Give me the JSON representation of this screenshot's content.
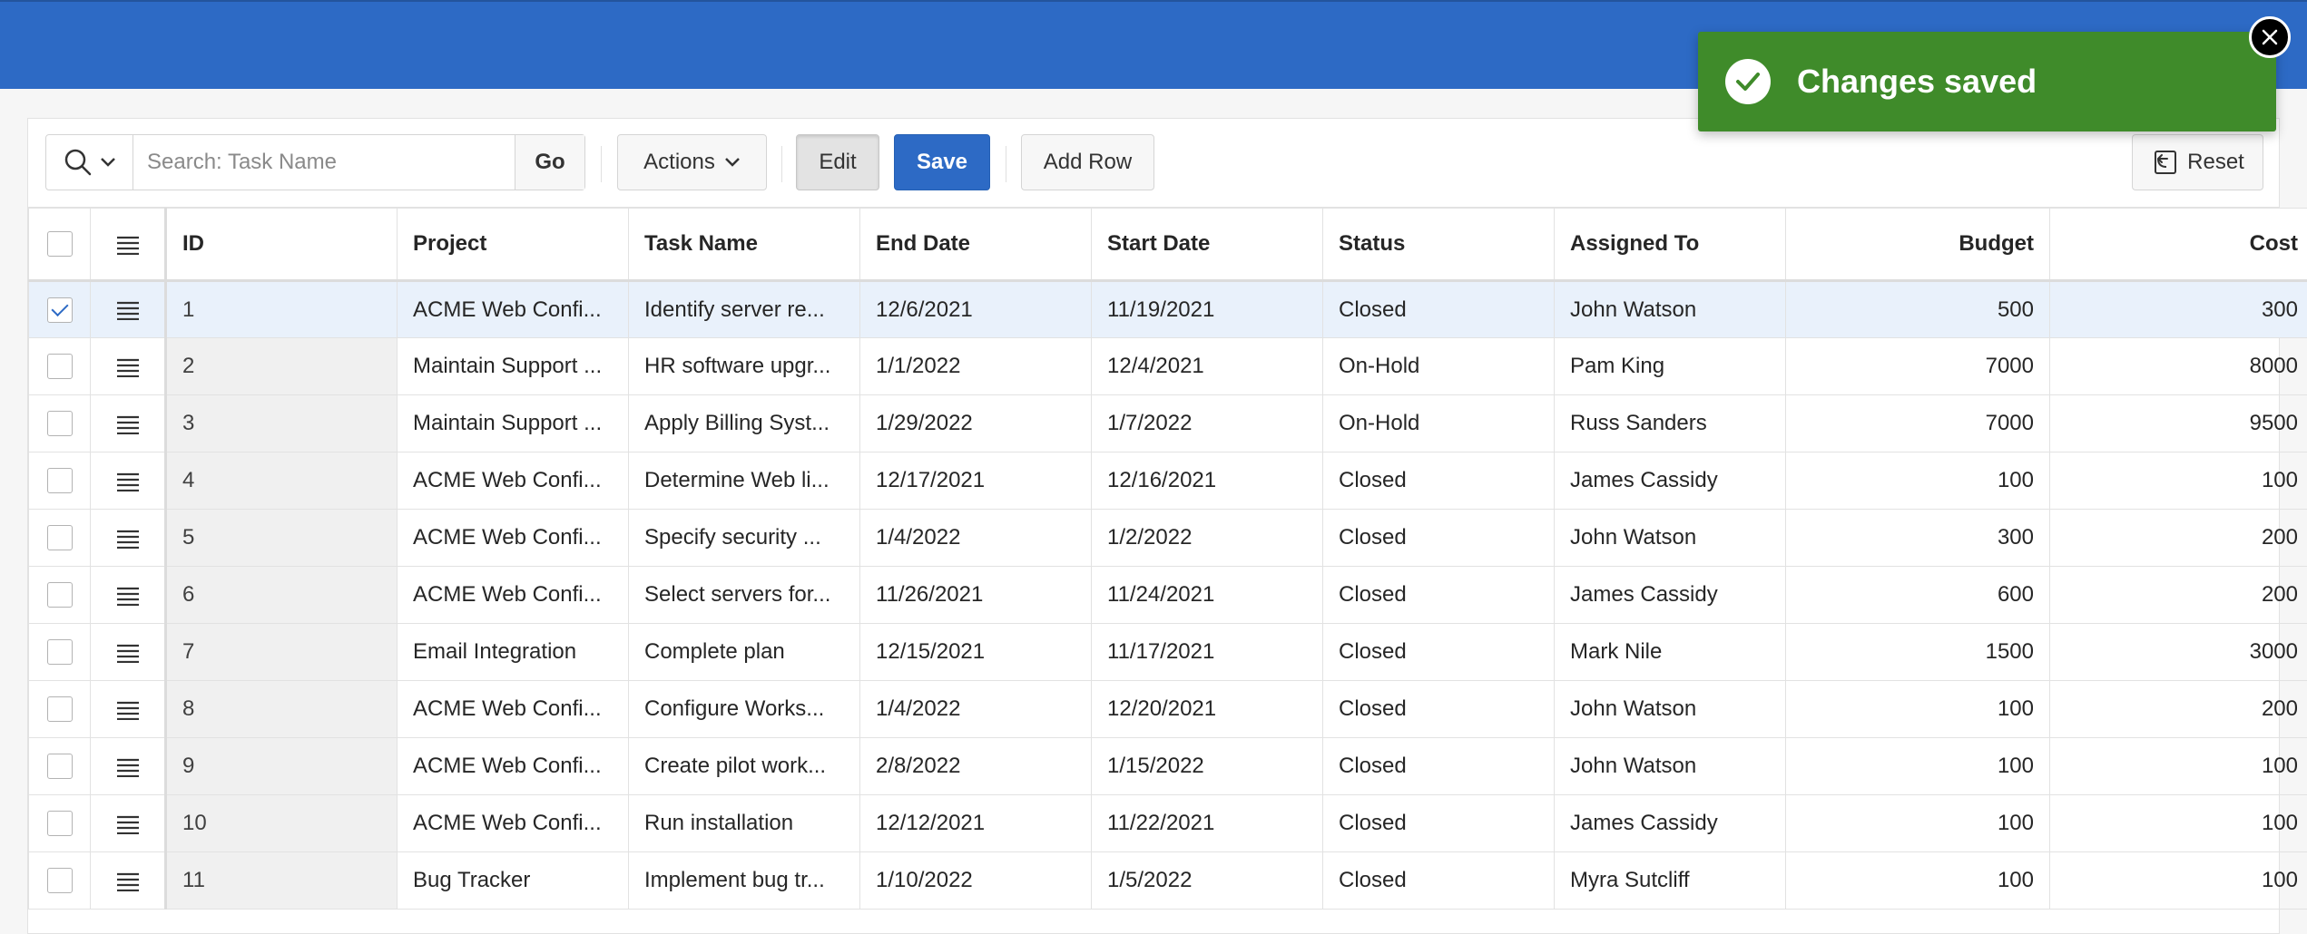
{
  "toolbar": {
    "search_placeholder": "Search: Task Name",
    "go_label": "Go",
    "actions_label": "Actions",
    "edit_label": "Edit",
    "save_label": "Save",
    "add_row_label": "Add Row",
    "reset_label": "Reset"
  },
  "columns": [
    "ID",
    "Project",
    "Task Name",
    "End Date",
    "Start Date",
    "Status",
    "Assigned To",
    "Budget",
    "Cost"
  ],
  "rows": [
    {
      "id": "1",
      "project": "ACME Web Confi...",
      "task": "Identify server re...",
      "end": "12/6/2021",
      "start": "11/19/2021",
      "status": "Closed",
      "assigned": "John Watson",
      "budget": "500",
      "cost": "300",
      "selected": true
    },
    {
      "id": "2",
      "project": "Maintain Support ...",
      "task": "HR software upgr...",
      "end": "1/1/2022",
      "start": "12/4/2021",
      "status": "On-Hold",
      "assigned": "Pam King",
      "budget": "7000",
      "cost": "8000",
      "selected": false
    },
    {
      "id": "3",
      "project": "Maintain Support ...",
      "task": "Apply Billing Syst...",
      "end": "1/29/2022",
      "start": "1/7/2022",
      "status": "On-Hold",
      "assigned": "Russ Sanders",
      "budget": "7000",
      "cost": "9500",
      "selected": false
    },
    {
      "id": "4",
      "project": "ACME Web Confi...",
      "task": "Determine Web li...",
      "end": "12/17/2021",
      "start": "12/16/2021",
      "status": "Closed",
      "assigned": "James Cassidy",
      "budget": "100",
      "cost": "100",
      "selected": false
    },
    {
      "id": "5",
      "project": "ACME Web Confi...",
      "task": "Specify security ...",
      "end": "1/4/2022",
      "start": "1/2/2022",
      "status": "Closed",
      "assigned": "John Watson",
      "budget": "300",
      "cost": "200",
      "selected": false
    },
    {
      "id": "6",
      "project": "ACME Web Confi...",
      "task": "Select servers for...",
      "end": "11/26/2021",
      "start": "11/24/2021",
      "status": "Closed",
      "assigned": "James Cassidy",
      "budget": "600",
      "cost": "200",
      "selected": false
    },
    {
      "id": "7",
      "project": "Email Integration",
      "task": "Complete plan",
      "end": "12/15/2021",
      "start": "11/17/2021",
      "status": "Closed",
      "assigned": "Mark Nile",
      "budget": "1500",
      "cost": "3000",
      "selected": false
    },
    {
      "id": "8",
      "project": "ACME Web Confi...",
      "task": "Configure Works...",
      "end": "1/4/2022",
      "start": "12/20/2021",
      "status": "Closed",
      "assigned": "John Watson",
      "budget": "100",
      "cost": "200",
      "selected": false
    },
    {
      "id": "9",
      "project": "ACME Web Confi...",
      "task": "Create pilot work...",
      "end": "2/8/2022",
      "start": "1/15/2022",
      "status": "Closed",
      "assigned": "John Watson",
      "budget": "100",
      "cost": "100",
      "selected": false
    },
    {
      "id": "10",
      "project": "ACME Web Confi...",
      "task": "Run installation",
      "end": "12/12/2021",
      "start": "11/22/2021",
      "status": "Closed",
      "assigned": "James Cassidy",
      "budget": "100",
      "cost": "100",
      "selected": false
    },
    {
      "id": "11",
      "project": "Bug Tracker",
      "task": "Implement bug tr...",
      "end": "1/10/2022",
      "start": "1/5/2022",
      "status": "Closed",
      "assigned": "Myra Sutcliff",
      "budget": "100",
      "cost": "100",
      "selected": false
    }
  ],
  "toast": {
    "message": "Changes saved"
  },
  "colors": {
    "header_blue": "#2d6ac5",
    "toast_green": "#3f8b2a",
    "selected_row": "#e9f1fb"
  }
}
